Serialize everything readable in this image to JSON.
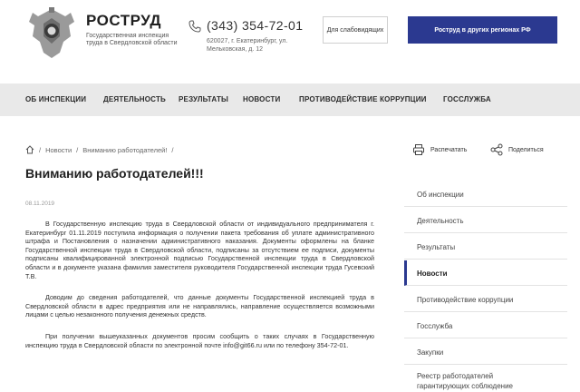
{
  "header": {
    "brand_name": "РОСТРУД",
    "brand_subtitle": "Государственная инспекция труда в Свердловской области",
    "phone": "(343) 354-72-01",
    "address": "620027, г. Екатеринбург, ул. Мельковская, д. 12",
    "visually_impaired_label": "Для слабовидящих",
    "regions_label": "Роструд в других регионах РФ"
  },
  "nav": {
    "items": [
      "ОБ ИНСПЕКЦИИ",
      "ДЕЯТЕЛЬНОСТЬ",
      "РЕЗУЛЬТАТЫ",
      "НОВОСТИ",
      "ПРОТИВОДЕЙСТВИЕ КОРРУПЦИИ",
      "ГОССЛУЖБА"
    ]
  },
  "breadcrumb": {
    "items": [
      "Новости",
      "Вниманию работодателей!"
    ],
    "separator": "/"
  },
  "actions": {
    "print_label": "Распечатать",
    "share_label": "Поделиться"
  },
  "article": {
    "title": "Вниманию работодателей!!!",
    "date": "08.11.2019",
    "paragraphs": [
      "В Государственную инспекцию труда в Свердловской области от индивидуального предпринимателя г. Екатеринбург 01.11.2019 поступила информация о получении пакета требования об уплате административного штрафа и Постановления о назначении административного наказания. Документы оформлены на бланке Государственной инспекции труда в Свердловской области, подписаны за отсутствием ее подписи, документы подписаны квалифицированной электронной подписью Государственной инспекции труда в Свердловской области и в документе указана фамилия заместителя руководителя Государственной инспекции труда Гусевский Т.В.",
      "Доводим до сведения работодателей, что данные документы Государственной инспекцией труда в Свердловской области в адрес предприятия или не направлялись, направление осуществляется возможными лицами с целью незаконного получения денежных средств.",
      "При получении вышеуказанных документов просим сообщить о таких случаях в Государственную инспекцию труда в Свердловской области по электронной почте info@git66.ru или по телефону 354-72-01."
    ]
  },
  "sidebar": {
    "items": [
      {
        "label": "Об инспекции",
        "line2": ""
      },
      {
        "label": "Деятельность",
        "line2": ""
      },
      {
        "label": "Результаты",
        "line2": ""
      },
      {
        "label": "Новости",
        "line2": ""
      },
      {
        "label": "Противодействие коррупции",
        "line2": ""
      },
      {
        "label": "Госслужба",
        "line2": ""
      },
      {
        "label": "Закупки",
        "line2": ""
      },
      {
        "label": "Реестр работодателей",
        "line2": "гарантирующих соблюдение"
      }
    ],
    "active_index": 3
  },
  "colors": {
    "accent": "#2b3990",
    "nav_bg": "#e9e9e9"
  }
}
